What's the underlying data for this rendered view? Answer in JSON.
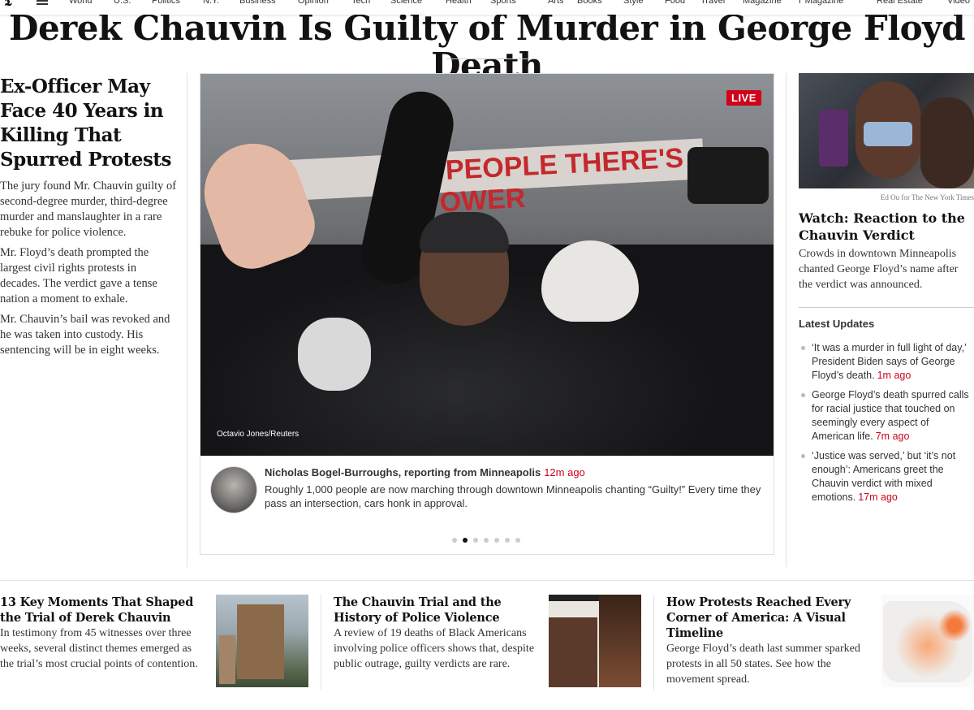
{
  "nav": {
    "logo": "𝕿",
    "items": [
      "World",
      "U.S.",
      "Politics",
      "N.Y.",
      "Business",
      "Opinion",
      "Tech",
      "Science",
      "Health",
      "Sports",
      "Arts",
      "Books",
      "Style",
      "Food",
      "Travel",
      "Magazine",
      "T Magazine",
      "Real Estate",
      "Video"
    ]
  },
  "headline": "Derek Chauvin Is Guilty of Murder in George Floyd Death",
  "lead": {
    "title": "Ex-Officer May Face 40 Years in Killing That Spurred Protests",
    "paragraphs": [
      "The jury found Mr. Chauvin guilty of second-degree murder, third-degree murder and manslaughter in a rare rebuke for police violence.",
      "Mr. Floyd’s death prompted the largest civil rights protests in decades. The verdict gave a tense nation a moment to exhale.",
      "Mr. Chauvin’s bail was revoked and he was taken into custody. His sentencing will be in eight weeks."
    ]
  },
  "live": {
    "badge": "LIVE",
    "photo_credit": "Octavio Jones/Reuters",
    "banner_text": "S PEOPLE THERE'S POWER",
    "reporter": "Nicholas Bogel-Burroughs, reporting from Minneapolis",
    "time": "12m ago",
    "text": "Roughly 1,000 people are now marching through downtown Minneapolis chanting “Guilty!” Every time they pass an intersection, cars honk in approval.",
    "slide_count": 7,
    "active_slide": 2
  },
  "side": {
    "credit": "Ed Ou for The New York Times",
    "title": "Watch: Reaction to the Chauvin Verdict",
    "summary": "Crowds in downtown Minneapolis chanted George Floyd’s name after the verdict was announced.",
    "updates_heading": "Latest Updates",
    "updates": [
      {
        "text": "‘It was a murder in full light of day,’ President Biden says of George Floyd’s death.",
        "time": "1m ago"
      },
      {
        "text": "George Floyd’s death spurred calls for racial justice that touched on seemingly every aspect of American life.",
        "time": "7m ago"
      },
      {
        "text": "‘Justice was served,’ but ‘it’s not enough’: Americans greet the Chauvin verdict with mixed emotions.",
        "time": "17m ago"
      }
    ]
  },
  "bottom": [
    {
      "title": "13 Key Moments That Shaped the Trial of Derek Chauvin",
      "summary": "In testimony from 45 witnesses over three weeks, several distinct themes emerged as the trial’s most crucial points of contention."
    },
    {
      "title": "The Chauvin Trial and the History of Police Violence",
      "summary": "A review of 19 deaths of Black Americans involving police officers shows that, despite public outrage, guilty verdicts are rare."
    },
    {
      "title": "How Protests Reached Every Corner of America: A Visual Timeline",
      "summary": "George Floyd’s death last summer sparked protests in all 50 states. See how the movement spread."
    }
  ]
}
